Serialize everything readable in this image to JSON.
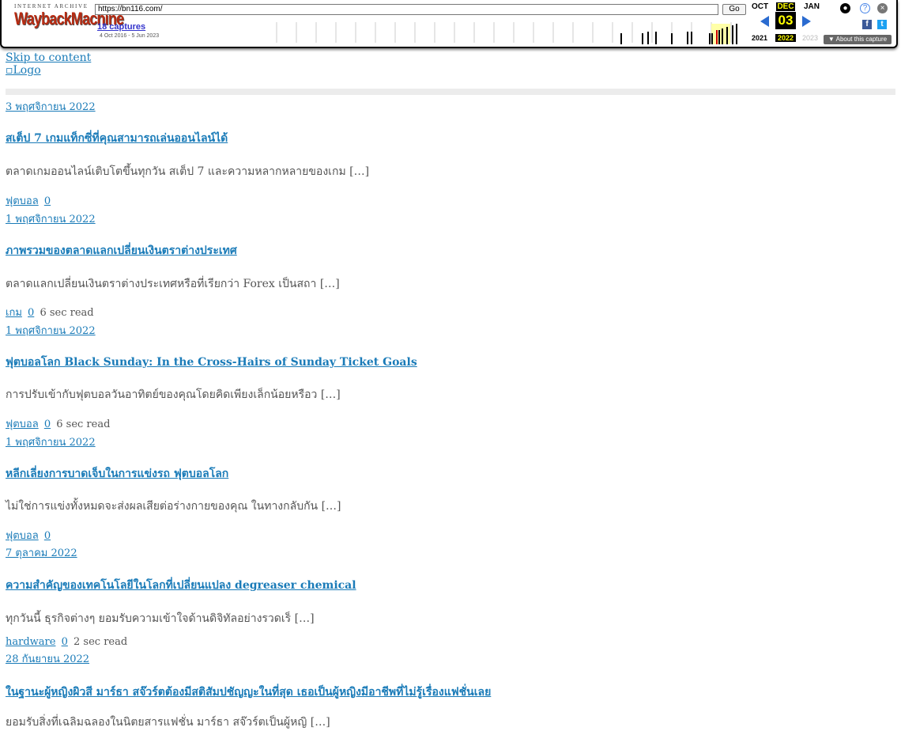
{
  "wayback": {
    "brand_top": "INTERNET ARCHIVE",
    "brand_logo": "WaybackMachine",
    "url": "https://bn116.com/",
    "go_label": "Go",
    "captures": "18 captures",
    "range": "4 Oct 2016 - 5 Jun 2023",
    "months": {
      "prev": "OCT",
      "current": "DEC",
      "next": "JAN"
    },
    "day": "03",
    "years": {
      "prev": "2021",
      "current": "2022",
      "next": "2023"
    },
    "about": "▼ About this capture",
    "icons": [
      "user-icon",
      "help-icon",
      "close-icon",
      "facebook-icon",
      "twitter-icon"
    ]
  },
  "page": {
    "skip": "Skip to content",
    "logo_alt": "Logo",
    "posts": [
      {
        "date": "3 พฤศจิกายน 2022",
        "title": "สเต็ป 7 เกมแท็กซี่ที่คุณสามารถเล่นออนไลน์ได้",
        "excerpt": "ตลาดเกมออนไลน์เติบโตขึ้นทุกวัน สเต็ป 7 และความหลากหลายของเกม […]",
        "category": "ฟุตบอล",
        "comments": "0",
        "read": ""
      },
      {
        "date": "1 พฤศจิกายน 2022",
        "title": "ภาพรวมของตลาดแลกเปลี่ยนเงินตราต่างประเทศ",
        "excerpt": "ตลาดแลกเปลี่ยนเงินตราต่างประเทศหรือที่เรียกว่า Forex เป็นสถา […]",
        "category": "เกม",
        "comments": "0",
        "read": "6 sec read"
      },
      {
        "date": "1 พฤศจิกายน 2022",
        "title": "ฟุตบอลโลก Black Sunday: In the Cross-Hairs of Sunday Ticket Goals",
        "excerpt": "การปรับเข้ากับฟุตบอลวันอาทิตย์ของคุณโดยคิดเพียงเล็กน้อยหรือว […]",
        "category": "ฟุตบอล",
        "comments": "0",
        "read": "6 sec read"
      },
      {
        "date": "1 พฤศจิกายน 2022",
        "title": "หลีกเลี่ยงการบาดเจ็บในการแข่งรถ ฟุตบอลโลก",
        "excerpt": "ไม่ใช่การแข่งทั้งหมดจะส่งผลเสียต่อร่างกายของคุณ ในทางกลับกัน […]",
        "category": "ฟุตบอล",
        "comments": "0",
        "read": ""
      },
      {
        "date": "7 ตุลาคม 2022",
        "title": "ความสำคัญของเทคโนโลยีในโลกที่เปลี่ยนแปลง degreaser chemical",
        "excerpt": "ทุกวันนี้ ธุรกิจต่างๆ ยอมรับความเข้าใจด้านดิจิทัลอย่างรวดเร็ […]",
        "category": "hardware",
        "comments": "0",
        "read": "2 sec read"
      },
      {
        "date": "28 กันยายน 2022",
        "title": "ในฐานะผู้หญิงผิวสี มาร์ธา สจ๊วร์ตต้องมีสติสัมปชัญญะในที่สุด เธอเป็นผู้หญิงมีอาชีพที่ไม่รู้เรื่องแฟชั่นเลย",
        "excerpt": "ยอมรับสิ่งที่เฉลิมฉลองในนิตยสารแฟชั่น มาร์ธา สจ๊วร์ตเป็นผู้หญิ […]",
        "category": "",
        "comments": "",
        "read": ""
      }
    ]
  }
}
